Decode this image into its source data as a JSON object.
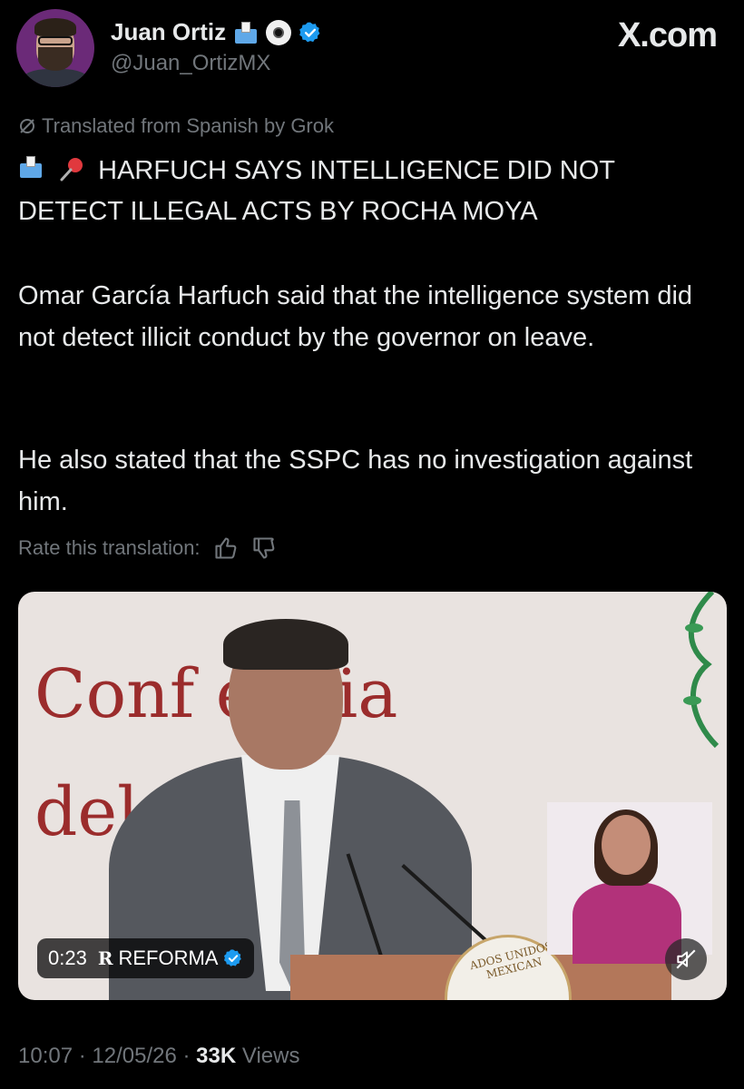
{
  "author": {
    "name": "Juan Ortiz",
    "handle": "@Juan_OrtizMX",
    "badge_icons": [
      "ballot-box-icon",
      "eye-icon",
      "verified-icon"
    ],
    "verified_color": "#1d9bf0"
  },
  "brand": {
    "logo_text": "X.com"
  },
  "tweet": {
    "translated_label": "Translated from Spanish by Grok",
    "headline_icons": [
      "ballot-box-icon",
      "pushpin-icon"
    ],
    "headline": "HARFUCH SAYS INTELLIGENCE DID NOT DETECT ILLEGAL ACTS BY ROCHA MOYA",
    "paragraph1": "Omar García Harfuch said that the intelligence system did not detect illicit conduct by the governor on leave.",
    "paragraph2": "He also stated that the SSPC has no investigation against him.",
    "rate_label": "Rate this translation:"
  },
  "media": {
    "backdrop_line1": "Conf     encia",
    "backdrop_line2": "del          o",
    "seal_text": "ADOS UNIDOS MEXICAN",
    "timestamp": "0:23",
    "source_logo": "R",
    "source_name": "REFORMA",
    "muted": true
  },
  "meta": {
    "time": "10:07",
    "date": "12/05/26",
    "views_count": "33K",
    "views_label": "Views"
  }
}
